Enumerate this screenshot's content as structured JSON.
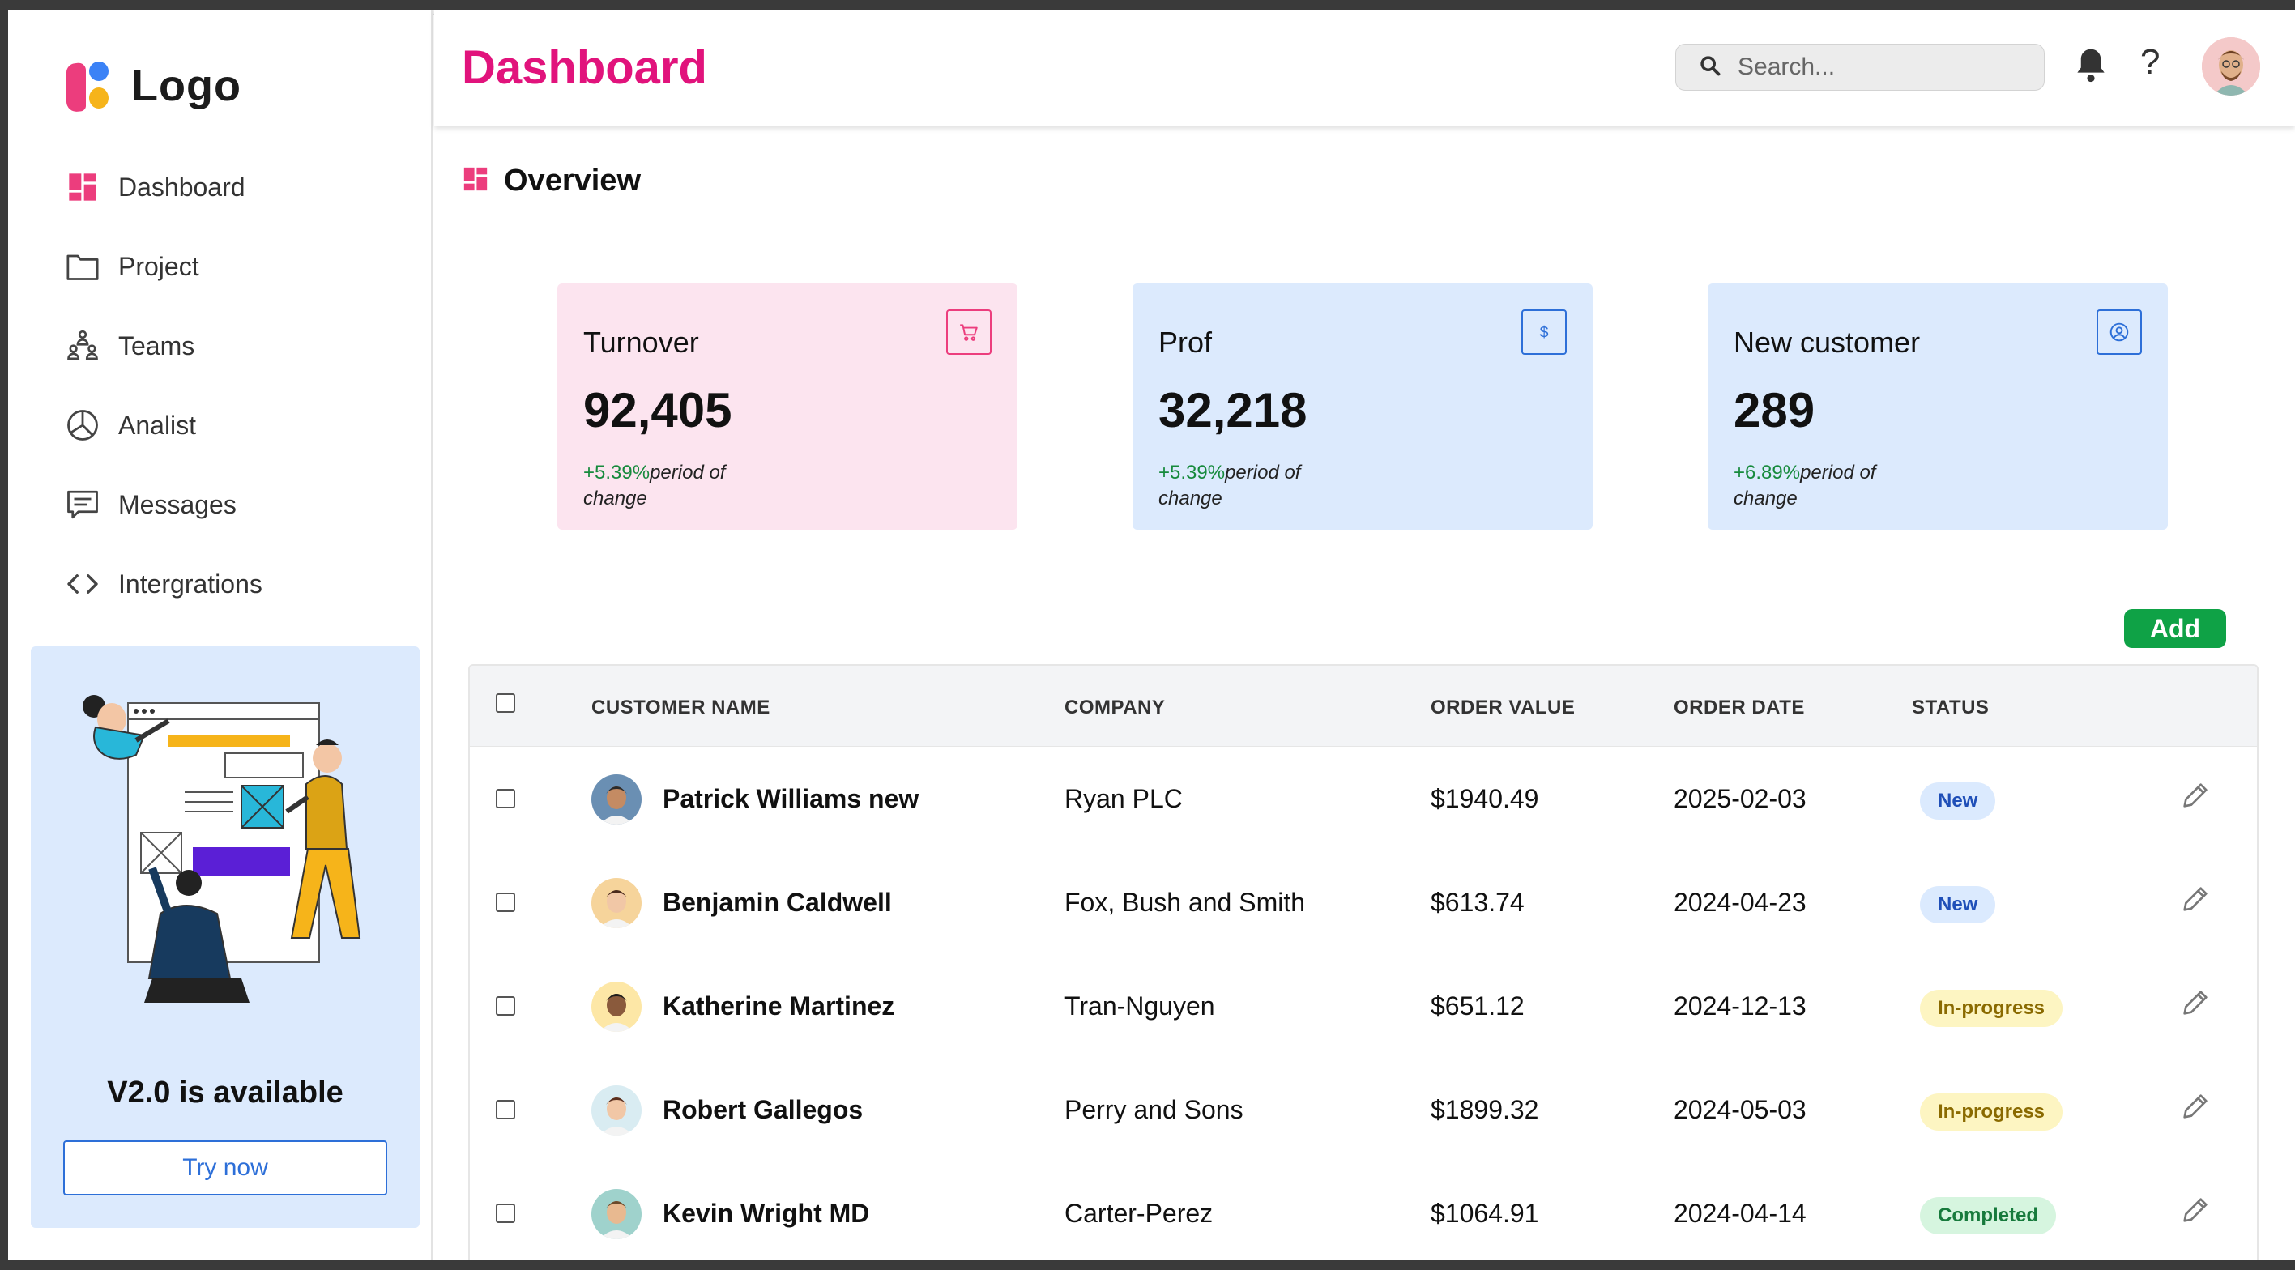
{
  "sidebar": {
    "logo_text": "Logo",
    "items": [
      {
        "label": "Dashboard",
        "icon": "dashboard-icon"
      },
      {
        "label": "Project",
        "icon": "folder-icon"
      },
      {
        "label": "Teams",
        "icon": "teams-icon"
      },
      {
        "label": "Analist",
        "icon": "pie-chart-icon"
      },
      {
        "label": "Messages",
        "icon": "message-icon"
      },
      {
        "label": "Intergrations",
        "icon": "code-icon"
      }
    ],
    "promo": {
      "title": "V2.0 is available",
      "button": "Try now"
    }
  },
  "header": {
    "title": "Dashboard",
    "search_placeholder": "Search...",
    "help_glyph": "?"
  },
  "overview": {
    "label": "Overview"
  },
  "cards": [
    {
      "title": "Turnover",
      "value": "92,405",
      "change": "+5.39%",
      "period": "period of change",
      "icon": "cart-icon",
      "bg": "#fce4ef",
      "accent": "#ec3d7d"
    },
    {
      "title": "Prof",
      "value": "32,218",
      "change": "+5.39%",
      "period": "period of change",
      "icon": "dollar-icon",
      "bg": "#dceafd",
      "accent": "#2d6fd8"
    },
    {
      "title": "New customer",
      "value": "289",
      "change": "+6.89%",
      "period": "period of change",
      "icon": "user-circle-icon",
      "bg": "#dceafd",
      "accent": "#2d6fd8"
    }
  ],
  "table": {
    "add_label": "Add",
    "columns": [
      "CUSTOMER NAME",
      "COMPANY",
      "ORDER VALUE",
      "ORDER DATE",
      "STATUS"
    ],
    "rows": [
      {
        "name": "Patrick Williams new",
        "company": "Ryan PLC",
        "value": "$1940.49",
        "date": "2025-02-03",
        "status": "New"
      },
      {
        "name": "Benjamin Caldwell",
        "company": "Fox, Bush and Smith",
        "value": "$613.74",
        "date": "2024-04-23",
        "status": "New"
      },
      {
        "name": "Katherine Martinez",
        "company": "Tran-Nguyen",
        "value": "$651.12",
        "date": "2024-12-13",
        "status": "In-progress"
      },
      {
        "name": "Robert Gallegos",
        "company": "Perry and Sons",
        "value": "$1899.32",
        "date": "2024-05-03",
        "status": "In-progress"
      },
      {
        "name": "Kevin Wright MD",
        "company": "Carter-Perez",
        "value": "$1064.91",
        "date": "2024-04-14",
        "status": "Completed"
      }
    ]
  },
  "colors": {
    "brand_pink": "#e1137c",
    "add_green": "#0fa246",
    "status_new_bg": "#dbeafe",
    "status_progress_bg": "#fdf5c2",
    "status_completed_bg": "#d6f5df"
  }
}
